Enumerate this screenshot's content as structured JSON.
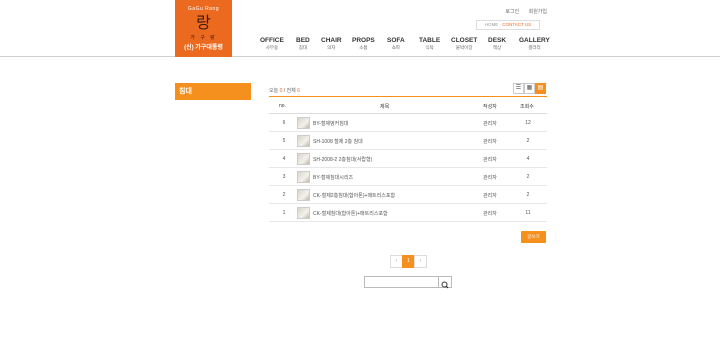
{
  "logo": {
    "en": "GaGu Rang",
    "big": "랑",
    "kr": "가 구 랑",
    "name": "(신) 가구대통령"
  },
  "toplinks": {
    "login": "로그인",
    "join": "회원가입"
  },
  "homebox": {
    "home": "HOME",
    "contact": "CONTACT US"
  },
  "nav": [
    {
      "en": "OFFICE",
      "kr": "사무용"
    },
    {
      "en": "BED",
      "kr": "침대"
    },
    {
      "en": "CHAIR",
      "kr": "의자"
    },
    {
      "en": "PROPS",
      "kr": "소품"
    },
    {
      "en": "SOFA",
      "kr": "쇼파"
    },
    {
      "en": "TABLE",
      "kr": "식탁"
    },
    {
      "en": "CLOSET",
      "kr": "붙박이장"
    },
    {
      "en": "DESK",
      "kr": "책상"
    },
    {
      "en": "GALLERY",
      "kr": "갤러리"
    }
  ],
  "side": {
    "title": "침대"
  },
  "count": {
    "today_label": "오늘",
    "today": "0",
    "total_label": "/ 전체",
    "total": "6"
  },
  "viewbtns": {
    "list": "☰",
    "grid": "▦",
    "thumb": "▤"
  },
  "table": {
    "headers": {
      "no": "no.",
      "title": "제목",
      "author": "작성자",
      "views": "조회수"
    },
    "rows": [
      {
        "no": "6",
        "title": "BY-철제벙커침대",
        "author": "관리자",
        "views": "12"
      },
      {
        "no": "5",
        "title": "SH-1008 철제 2층 침대",
        "author": "관리자",
        "views": "2"
      },
      {
        "no": "4",
        "title": "SH-2008-2 2층침대(서랍형)",
        "author": "관리자",
        "views": "4"
      },
      {
        "no": "3",
        "title": "BY-철제침대시리즈",
        "author": "관리자",
        "views": "2"
      },
      {
        "no": "2",
        "title": "CK-철제2층침대(합아톤)+매트리스포함",
        "author": "관리자",
        "views": "2"
      },
      {
        "no": "1",
        "title": "CK-철제침대(합아톤)+매트리스포함",
        "author": "관리자",
        "views": "11"
      }
    ]
  },
  "write_button": "글쓰기",
  "pager": {
    "prev": "‹",
    "current": "1",
    "next": "›"
  },
  "search": {
    "value": "",
    "icon": "search-icon"
  }
}
